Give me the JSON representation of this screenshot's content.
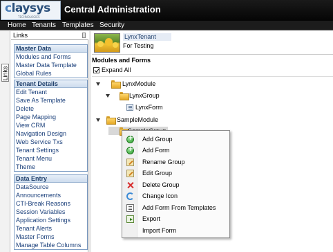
{
  "header": {
    "logo_text_prefix": "c",
    "logo_text": "laysys",
    "logo_subtext": "TECHNOLOGIES",
    "app_title": "Central Administration"
  },
  "menu": [
    "Home",
    "Tenants",
    "Templates",
    "Security"
  ],
  "vtab_label": "Links",
  "links_pane": {
    "title": "Links",
    "groups": [
      {
        "title": "Master Data",
        "items": [
          "Modules and Forms",
          "Master Data Template",
          "Global Rules"
        ]
      },
      {
        "title": "Tenant Details",
        "items": [
          "Edit Tenant",
          "Save As Template",
          "Delete",
          "Page Mapping",
          "View CRM",
          "Navigation Design",
          "Web Service Txs",
          "Tenant Settings",
          "Tenant Menu",
          "Theme"
        ]
      },
      {
        "title": "Data Entry",
        "items": [
          "DataSource",
          "Announcements",
          "CTI-Break Reasons",
          "Session Variables",
          "Application Settings",
          "Tenant Alerts",
          "Master Forms",
          "Manage Table Columns"
        ]
      }
    ]
  },
  "tenant": {
    "name": "LynxTenant",
    "description": "For Testing"
  },
  "main": {
    "section_title": "Modules and Forms",
    "expand_all_label": "Expand All",
    "expand_all_checked": true,
    "tree": {
      "lynx_module": "LynxModule",
      "lynx_group": "LynxGroup",
      "lynx_form": "LynxForm",
      "sample_module": "SampleModule",
      "sample_group": "SampleGroup"
    }
  },
  "context_menu": {
    "items": [
      {
        "label": "Add Group",
        "icon": "add-icon"
      },
      {
        "label": "Add Form",
        "icon": "add-icon"
      },
      {
        "label": "Rename Group",
        "icon": "pencil-icon"
      },
      {
        "label": "Edit Group",
        "icon": "pencil-icon"
      },
      {
        "label": "Delete Group",
        "icon": "delete-x-icon"
      },
      {
        "label": "Change Icon",
        "icon": "refresh-icon"
      },
      {
        "label": "Add Form From Templates",
        "icon": "template-icon"
      },
      {
        "label": "Export",
        "icon": "export-icon"
      },
      {
        "label": "Import Form",
        "icon": ""
      }
    ]
  }
}
